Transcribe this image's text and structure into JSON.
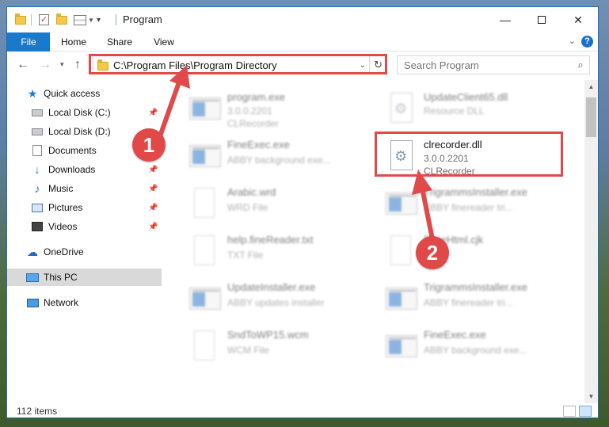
{
  "window": {
    "title": "Program"
  },
  "ribbon": {
    "tabs": [
      "File",
      "Home",
      "Share",
      "View"
    ],
    "help": "?"
  },
  "address": {
    "path": "C:\\Program Files\\Program Directory"
  },
  "search": {
    "placeholder": "Search Program"
  },
  "sidebar": {
    "items": [
      {
        "label": "Quick access",
        "icon": "star-icon",
        "pinned": false
      },
      {
        "label": "Local Disk (C:)",
        "icon": "disk-icon",
        "pinned": true
      },
      {
        "label": "Local Disk (D:)",
        "icon": "disk-icon",
        "pinned": false
      },
      {
        "label": "Documents",
        "icon": "documents-icon",
        "pinned": false
      },
      {
        "label": "Downloads",
        "icon": "downloads-icon",
        "pinned": true
      },
      {
        "label": "Music",
        "icon": "music-icon",
        "pinned": true
      },
      {
        "label": "Pictures",
        "icon": "pictures-icon",
        "pinned": true
      },
      {
        "label": "Videos",
        "icon": "videos-icon",
        "pinned": true
      },
      {
        "label": "OneDrive",
        "icon": "onedrive-icon",
        "pinned": false
      },
      {
        "label": "This PC",
        "icon": "this-pc-icon",
        "pinned": false,
        "selected": true
      },
      {
        "label": "Network",
        "icon": "network-icon",
        "pinned": false
      }
    ]
  },
  "files": [
    {
      "name": "program.exe",
      "line1": "3.0.0.2201",
      "line2": "CLRecorder",
      "icon": "installer-icon",
      "blurred": true
    },
    {
      "name": "UpdateClient65.dll",
      "line1": "Resource DLL",
      "line2": "",
      "icon": "dll-icon",
      "blurred": true
    },
    {
      "name": "FineExec.exe",
      "line1": "ABBY background exe...",
      "line2": "",
      "icon": "app-icon",
      "blurred": true
    },
    {
      "name": "clrecorder.dll",
      "line1": "3.0.0.2201",
      "line2": "CLRecorder",
      "icon": "dll-icon",
      "blurred": false,
      "highlighted": true
    },
    {
      "name": "Arabic.wrd",
      "line1": "WRD File",
      "line2": "",
      "icon": "document-icon",
      "blurred": true
    },
    {
      "name": "TrigrammsInstaller.exe",
      "line1": "ABBY finereader tri...",
      "line2": "",
      "icon": "app-icon",
      "blurred": true
    },
    {
      "name": "help.fineReader.txt",
      "line1": "TXT File",
      "line2": "",
      "icon": "document-icon",
      "blurred": true
    },
    {
      "name": "FaceHtml.cjk",
      "line1": "",
      "line2": "",
      "icon": "document-icon",
      "blurred": true
    },
    {
      "name": "UpdateInstaller.exe",
      "line1": "ABBY updates installer",
      "line2": "",
      "icon": "app-icon",
      "blurred": true
    },
    {
      "name": "TrigrammsInstaller.exe",
      "line1": "ABBY finereader tri...",
      "line2": "",
      "icon": "app-icon",
      "blurred": true
    },
    {
      "name": "SndToWP15.wcm",
      "line1": "WCM File",
      "line2": "",
      "icon": "document-icon",
      "blurred": true
    },
    {
      "name": "FineExec.exe",
      "line1": "ABBY background exe...",
      "line2": "",
      "icon": "app-icon",
      "blurred": true
    }
  ],
  "status": {
    "count": "112 items"
  },
  "annotations": {
    "badge1": "1",
    "badge2": "2",
    "color": "#e04a4a"
  }
}
